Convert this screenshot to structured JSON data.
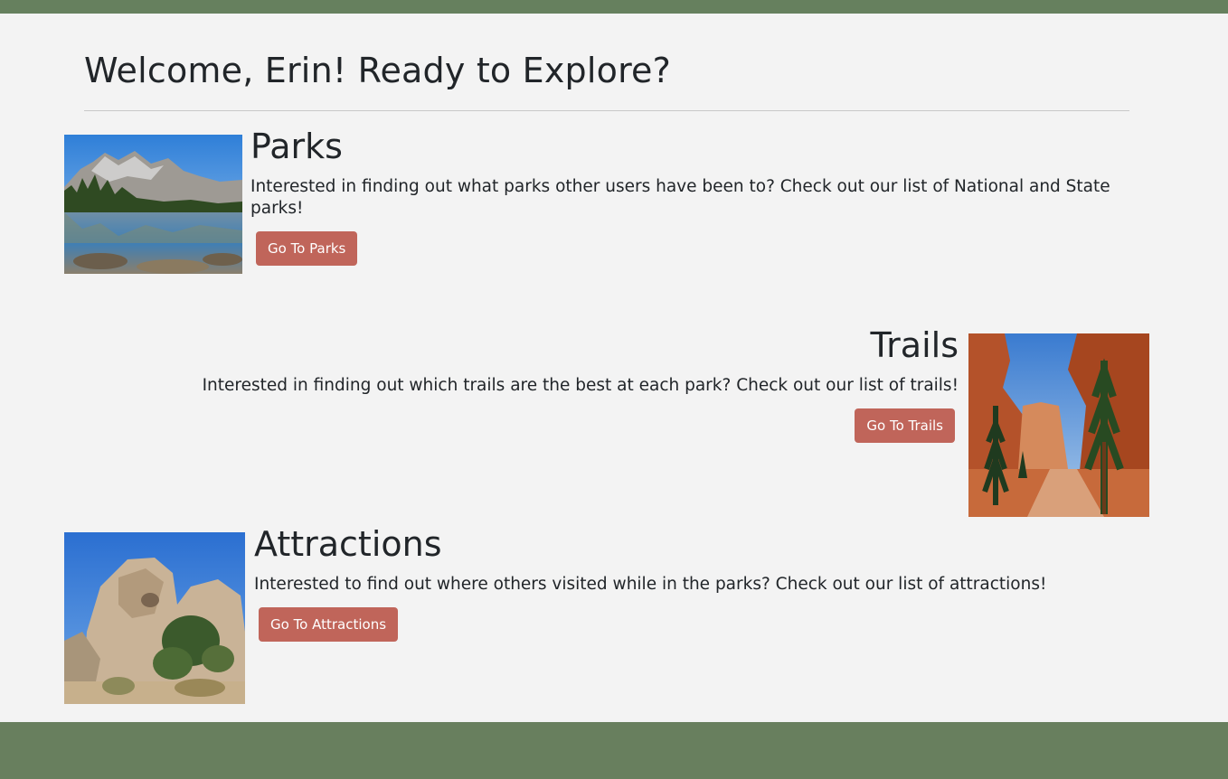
{
  "header": {
    "welcome": "Welcome, Erin! Ready to Explore?"
  },
  "sections": [
    {
      "title": "Parks",
      "description": "Interested in finding out what parks other users have been to? Check out our list of National and State parks!",
      "button_label": "Go To Parks",
      "image_alt": "Mountain lake reflection"
    },
    {
      "title": "Trails",
      "description": "Interested in finding out which trails are the best at each park? Check out our list of trails!",
      "button_label": "Go To Trails",
      "image_alt": "Red rock canyon trail with pine trees"
    },
    {
      "title": "Attractions",
      "description": "Interested to find out where others visited while in the parks? Check out our list of attractions!",
      "button_label": "Go To Attractions",
      "image_alt": "Desert rock formation with shrubs"
    }
  ],
  "colors": {
    "header_bar": "#66805e",
    "footer": "#687f5e",
    "button": "#c0655a",
    "background": "#f3f3f3"
  }
}
